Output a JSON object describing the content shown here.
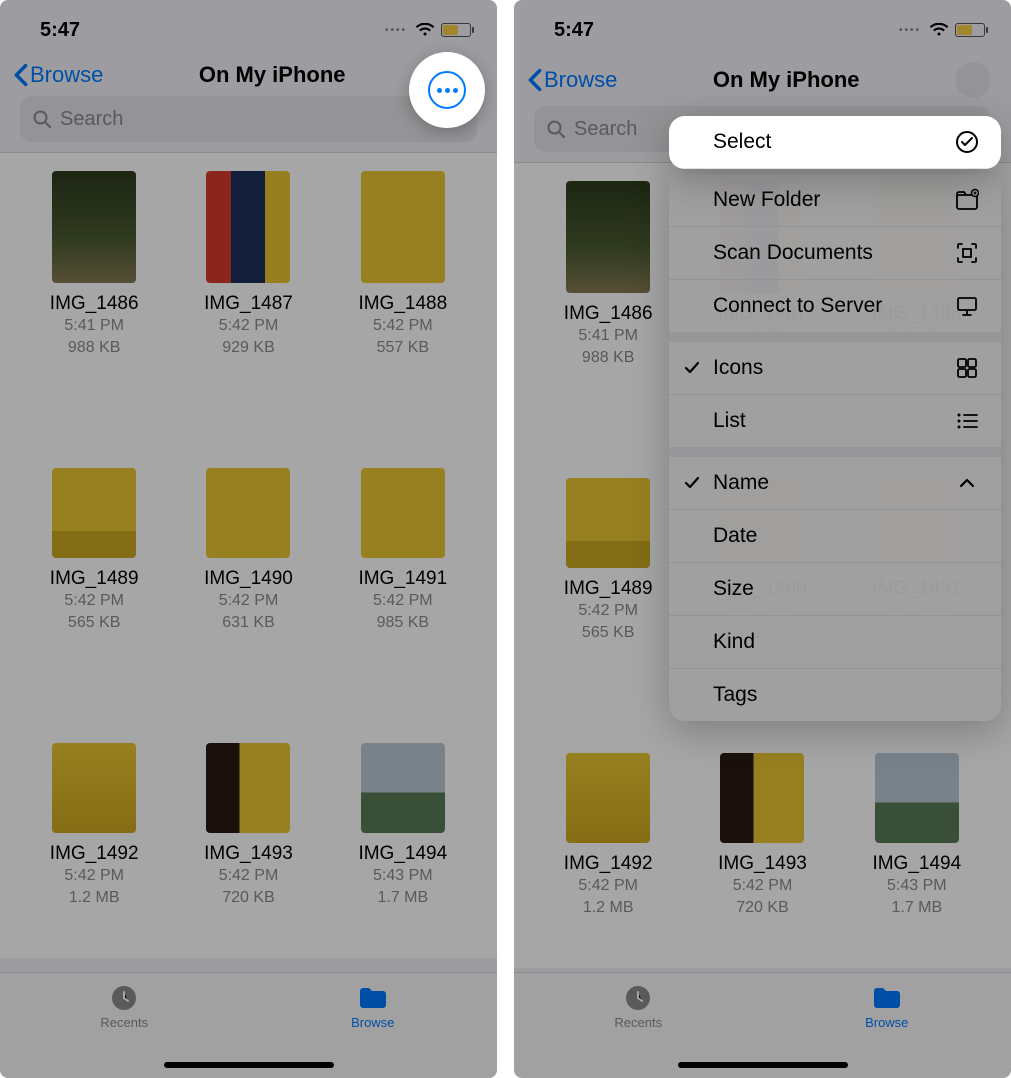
{
  "status": {
    "time": "5:47"
  },
  "nav": {
    "back": "Browse",
    "title": "On My iPhone"
  },
  "search": {
    "placeholder": "Search"
  },
  "files": [
    {
      "name": "IMG_1486",
      "time": "5:41 PM",
      "size": "988 KB",
      "thumb": "t1"
    },
    {
      "name": "IMG_1487",
      "time": "5:42 PM",
      "size": "929 KB",
      "thumb": "t2"
    },
    {
      "name": "IMG_1488",
      "time": "5:42 PM",
      "size": "557 KB",
      "thumb": "t3"
    },
    {
      "name": "IMG_1489",
      "time": "5:42 PM",
      "size": "565 KB",
      "thumb": "t4"
    },
    {
      "name": "IMG_1490",
      "time": "5:42 PM",
      "size": "631 KB",
      "thumb": "t5"
    },
    {
      "name": "IMG_1491",
      "time": "5:42 PM",
      "size": "985 KB",
      "thumb": "t6"
    },
    {
      "name": "IMG_1492",
      "time": "5:42 PM",
      "size": "1.2 MB",
      "thumb": "t7"
    },
    {
      "name": "IMG_1493",
      "time": "5:42 PM",
      "size": "720 KB",
      "thumb": "t8"
    },
    {
      "name": "IMG_1494",
      "time": "5:43 PM",
      "size": "1.7 MB",
      "thumb": "t9"
    }
  ],
  "tabs": {
    "recents": "Recents",
    "browse": "Browse"
  },
  "menu": {
    "select": "Select",
    "new_folder": "New Folder",
    "scan": "Scan Documents",
    "connect": "Connect to Server",
    "icons": "Icons",
    "list": "List",
    "name": "Name",
    "date": "Date",
    "size": "Size",
    "kind": "Kind",
    "tags": "Tags"
  }
}
